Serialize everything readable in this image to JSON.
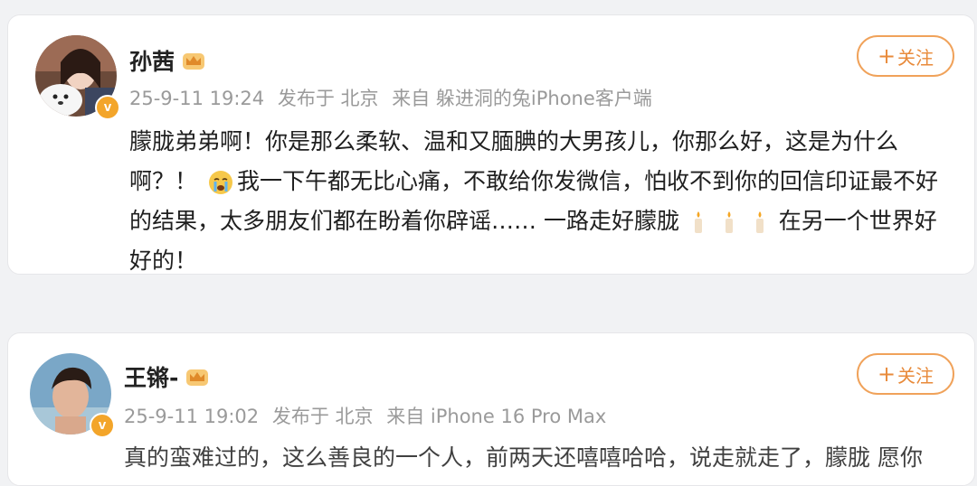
{
  "posts": [
    {
      "username": "孙茜",
      "date": "25-9-11 19:24",
      "location": "发布于 北京",
      "source": "来自 躲进洞的兔iPhone客户端",
      "follow_label": "关注",
      "content": {
        "part1": "朦胧弟弟啊！你是那么柔软、温和又腼腆的大男孩儿，你那么好，这是为什么啊？！",
        "part2": "我一下午都无比心痛，不敢给你发微信，怕收不到你的回信印证最不好的结果，太多朋友们都在盼着你辟谣…… 一路走好朦胧",
        "part3": "在另一个世界好好的！"
      },
      "emojis": [
        "crying-emoji",
        "candle-emoji",
        "candle-emoji",
        "candle-emoji"
      ]
    },
    {
      "username": "王锵-",
      "date": "25-9-11 19:02",
      "location": "发布于 北京",
      "source": "来自 iPhone 16 Pro Max",
      "follow_label": "关注",
      "content": {
        "part1": "真的蛮难过的，这么善良的一个人，前两天还嘻嘻哈哈，说走就走了，朦胧 愿你"
      }
    }
  ],
  "badge_label": "v",
  "colors": {
    "accent": "#f0a25a",
    "meta": "#9a9a9a",
    "badge": "#f3a52a"
  },
  "icons": [
    "crown-icon",
    "verified-badge-icon",
    "plus-icon"
  ]
}
